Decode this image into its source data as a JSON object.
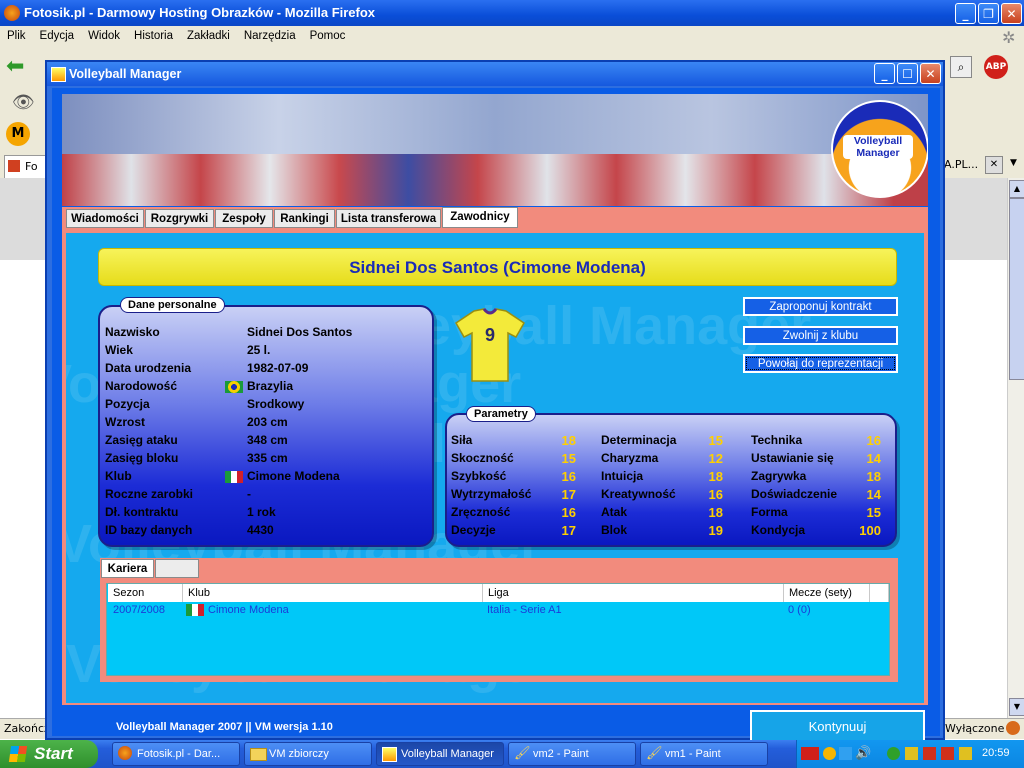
{
  "firefox": {
    "title": "Fotosik.pl - Darmowy Hosting Obrazków - Mozilla Firefox",
    "menu": [
      "Plik",
      "Edycja",
      "Widok",
      "Historia",
      "Zakładki",
      "Narzędzia",
      "Pomoc"
    ],
    "tab_label": "Fo",
    "status_left": "Zakończ",
    "status_right": "Wyłączone",
    "right_tab_label": "A.PL..."
  },
  "vm": {
    "title": "Volleyball Manager",
    "logo_text": "Volleyball Manager",
    "tabs": [
      "Wiadomości",
      "Rozgrywki",
      "Zespoły",
      "Rankingi",
      "Lista transferowa",
      "Zawodnicy"
    ],
    "active_tab": "Zawodnicy",
    "player_header": "Sidnei Dos Santos (Cimone Modena)",
    "shirt_number": "9",
    "personal_label": "Dane personalne",
    "personal": [
      {
        "label": "Nazwisko",
        "value": "Sidnei Dos Santos"
      },
      {
        "label": "Wiek",
        "value": "25 l."
      },
      {
        "label": "Data urodzenia",
        "value": "1982-07-09"
      },
      {
        "label": "Narodowość",
        "value": "Brazylia"
      },
      {
        "label": "Pozycja",
        "value": "Srodkowy"
      },
      {
        "label": "Wzrost",
        "value": "203 cm"
      },
      {
        "label": "Zasięg ataku",
        "value": "348 cm"
      },
      {
        "label": "Zasięg bloku",
        "value": "335 cm"
      },
      {
        "label": "Klub",
        "value": "Cimone Modena"
      },
      {
        "label": "Roczne zarobki",
        "value": "-"
      },
      {
        "label": "Dł. kontraktu",
        "value": "1 rok"
      },
      {
        "label": "ID bazy danych",
        "value": "4430"
      }
    ],
    "actions": [
      "Zaproponuj kontrakt",
      "Zwolnij z klubu",
      "Powołaj do reprezentacji"
    ],
    "params_label": "Parametry",
    "params": [
      [
        {
          "label": "Siła",
          "value": "18"
        },
        {
          "label": "Skoczność",
          "value": "15"
        },
        {
          "label": "Szybkość",
          "value": "16"
        },
        {
          "label": "Wytrzymałość",
          "value": "17"
        },
        {
          "label": "Zręczność",
          "value": "16"
        },
        {
          "label": "Decyzje",
          "value": "17"
        }
      ],
      [
        {
          "label": "Determinacja",
          "value": "15"
        },
        {
          "label": "Charyzma",
          "value": "12"
        },
        {
          "label": "Intuicja",
          "value": "18"
        },
        {
          "label": "Kreatywność",
          "value": "16"
        },
        {
          "label": "Atak",
          "value": "18"
        },
        {
          "label": "Blok",
          "value": "19"
        }
      ],
      [
        {
          "label": "Technika",
          "value": "16"
        },
        {
          "label": "Ustawianie się",
          "value": "14"
        },
        {
          "label": "Zagrywka",
          "value": "18"
        },
        {
          "label": "Doświadczenie",
          "value": "14"
        },
        {
          "label": "Forma",
          "value": "15"
        },
        {
          "label": "Kondycja",
          "value": "100"
        }
      ]
    ],
    "career_tab": "Kariera",
    "career_columns": [
      "Sezon",
      "Klub",
      "Liga",
      "Mecze (sety)"
    ],
    "career_rows": [
      {
        "season": "2007/2008",
        "club": "Cimone Modena",
        "league": "Italia - Serie A1",
        "matches": "0 (0)"
      }
    ],
    "footer": "Volleyball Manager 2007 || VM wersja 1.10",
    "continue": "Kontynuuj",
    "watermark": "Volleyball Manager"
  },
  "taskbar": {
    "start": "Start",
    "tasks": [
      "Fotosik.pl - Dar...",
      "VM zbiorczy",
      "Volleyball Manager",
      "vm2 - Paint",
      "vm1 - Paint"
    ],
    "active_task": "Volleyball Manager",
    "clock": "20:59"
  },
  "colors": {
    "xp_blue": "#0a4ed8",
    "vm_background": "#15a9ee",
    "highlight_yellow": "#ffd000",
    "tab_strip": "#f28b7d"
  }
}
